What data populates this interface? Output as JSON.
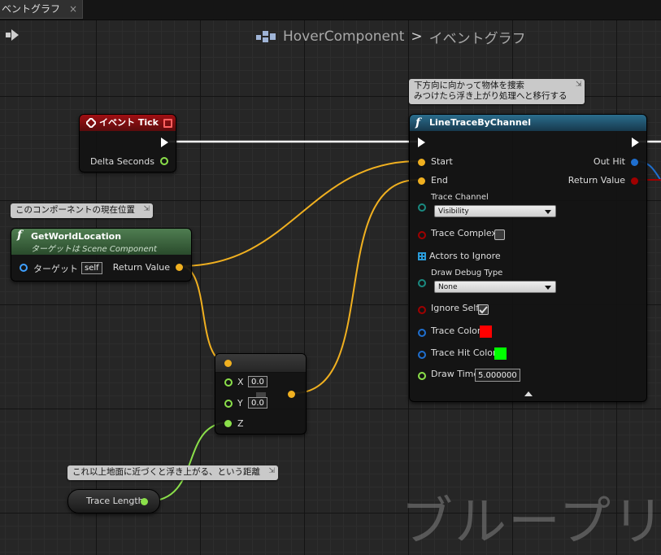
{
  "tab": {
    "label": "ベントグラフ",
    "close": "×"
  },
  "breadcrumb": {
    "component": "HoverComponent",
    "separator": ">",
    "graph": "イベントグラフ"
  },
  "watermark": "ブループリ",
  "event_tick": {
    "title": "イベント Tick",
    "delta_label": "Delta Seconds"
  },
  "get_world_location": {
    "comment": "このコンポーネントの現在位置",
    "title": "GetWorldLocation",
    "subtitle": "ターゲットは Scene Component",
    "target_label": "ターゲット",
    "target_value": "self",
    "return_label": "Return Value"
  },
  "make_vector": {
    "x_label": "X",
    "x_value": "0.0",
    "y_label": "Y",
    "y_value": "0.0",
    "z_label": "Z"
  },
  "trace_length": {
    "comment": "これ以上地面に近づくと浮き上がる、という距離",
    "label": "Trace Length"
  },
  "line_trace": {
    "comment_line1": "下方向に向かって物体を捜索",
    "comment_line2": "みつけたら浮き上がり処理へと移行する",
    "title": "LineTraceByChannel",
    "start_label": "Start",
    "end_label": "End",
    "out_hit_label": "Out Hit",
    "return_label": "Return Value",
    "trace_channel_label": "Trace Channel",
    "trace_channel_value": "Visibility",
    "trace_complex_label": "Trace Complex",
    "actors_ignore_label": "Actors to Ignore",
    "draw_debug_label": "Draw Debug Type",
    "draw_debug_value": "None",
    "ignore_self_label": "Ignore Self",
    "trace_color_label": "Trace Color",
    "trace_hit_color_label": "Trace Hit Color",
    "draw_time_label": "Draw Time",
    "draw_time_value": "5.000000"
  },
  "colors": {
    "trace_color": "#ff0000",
    "trace_hit_color": "#00ff00",
    "vector_wire": "#f0b020",
    "float_wire": "#8be04a",
    "exec_wire": "#ffffff"
  },
  "icons": [
    "close-icon",
    "nav-arrow-icon",
    "blueprint-icon",
    "event-diamond-icon",
    "function-icon",
    "exec-pin-icon",
    "checkmark-icon",
    "dropdown-arrow-icon",
    "pin-icon",
    "expand-arrow-icon"
  ]
}
